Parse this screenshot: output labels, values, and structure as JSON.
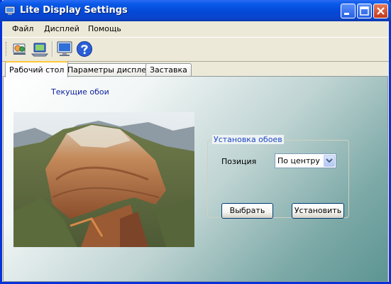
{
  "window": {
    "title": "Lite Display Settings",
    "icons": [
      "app-icon",
      "minimize-icon",
      "maximize-icon",
      "close-icon"
    ]
  },
  "menu": [
    "Файл",
    "Дисплей",
    "Помощь"
  ],
  "toolbar": {
    "icons": [
      "palette-tool-icon",
      "display-settings-icon",
      "monitor-icon",
      "help-icon"
    ]
  },
  "tabs": [
    {
      "label": "Рабочий стол",
      "active": true
    },
    {
      "label": "Параметры дисплея",
      "active": false
    },
    {
      "label": "Заставка",
      "active": false
    }
  ],
  "desktop": {
    "current_wallpaper_label": "Текущие обои",
    "wallpaper_group_title": "Установка обоев",
    "position_label": "Позиция",
    "position_value": "По центру",
    "choose_button": "Выбрать",
    "set_button": "Установить"
  },
  "colors": {
    "title_bar": "#0348D6",
    "label_blue": "#0A1F9C",
    "group_title_blue": "#1E46C4",
    "tab_highlight": "#FFC83C"
  }
}
